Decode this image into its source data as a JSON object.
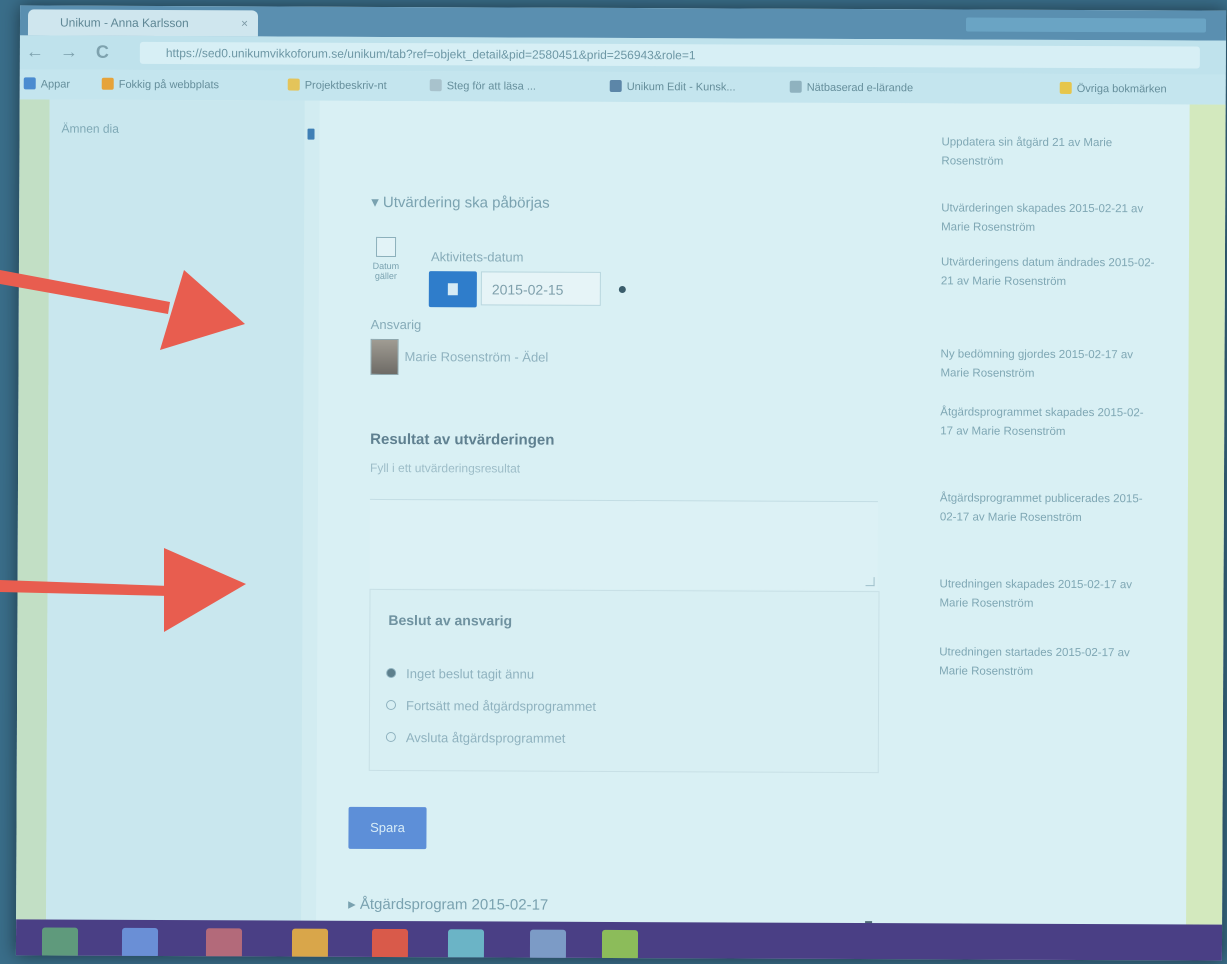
{
  "browser": {
    "tab_title": "Unikum - Anna Karlsson",
    "tab_close": "×",
    "url": "https://sed0.unikumvikkoforum.se/unikum/tab?ref=objekt_detail&pid=2580451&prid=256943&role=1",
    "back": "←",
    "forward": "→",
    "reload": "C",
    "bookmarks": [
      {
        "label": "Appar",
        "color": "#4a8bd0"
      },
      {
        "label": "Fokkig på webbplats",
        "color": "#e6a33a"
      },
      {
        "label": "Projektbeskriv-nt",
        "color": "#e4c45a"
      },
      {
        "label": "Steg för att läsa ...",
        "color": "#a8c2cc"
      },
      {
        "label": "Unikum Edit - Kunsk...",
        "color": "#5c86a8"
      },
      {
        "label": "Nätbaserad e-lärande",
        "color": "#8fb2bf"
      },
      {
        "label": "Övriga bokmärken",
        "color": "#e6c64c"
      }
    ]
  },
  "left_nav": {
    "item": "Ämnen dia"
  },
  "form": {
    "section_toggle": "▾ Utvärdering ska påbörjas",
    "date_icon_label": "Datum gäller",
    "date_label": "Aktivitets-datum",
    "date_value": "2015-02-15",
    "ansvarig_label": "Ansvarig",
    "person": "Marie Rosenström - Ädel",
    "result_title": "Resultat av utvärderingen",
    "result_hint": "Fyll i ett utvärderingsresultat",
    "fieldset_title": "Beslut av ansvarig",
    "options": [
      {
        "label": "Inget beslut tagit ännu",
        "selected": true
      },
      {
        "label": "Fortsätt med åtgärdsprogrammet",
        "selected": false
      },
      {
        "label": "Avsluta åtgärdsprogrammet",
        "selected": false
      }
    ],
    "save_label": "Spara",
    "bottom_toggle": "▸ Åtgärdsprogram 2015-02-17"
  },
  "activity": [
    "Uppdatera sin åtgärd 21 av Marie Rosenström",
    "Utvärderingen skapades 2015-02-21 av Marie Rosenström",
    "Utvärderingens datum ändrades 2015-02-21 av Marie Rosenström",
    "Ny bedömning gjordes 2015-02-17 av Marie Rosenström",
    "Åtgärdsprogrammet skapades 2015-02-17 av Marie Rosenström",
    "Åtgärdsprogrammet publicerades 2015-02-17 av Marie Rosenström",
    "Utredningen skapades 2015-02-17 av Marie Rosenström",
    "Utredningen startades 2015-02-17 av Marie Rosenström"
  ],
  "colors": {
    "accent": "#2f7dcb",
    "arrow": "#e85d4f",
    "save_button": "#5d8fd8",
    "taskbar": "#4a3f85"
  },
  "taskbar_apps": [
    "file-explorer-icon",
    "internet-explorer-icon",
    "window-icon",
    "folder-icon",
    "chrome-icon",
    "photos-icon",
    "document-icon",
    "game-icon"
  ]
}
